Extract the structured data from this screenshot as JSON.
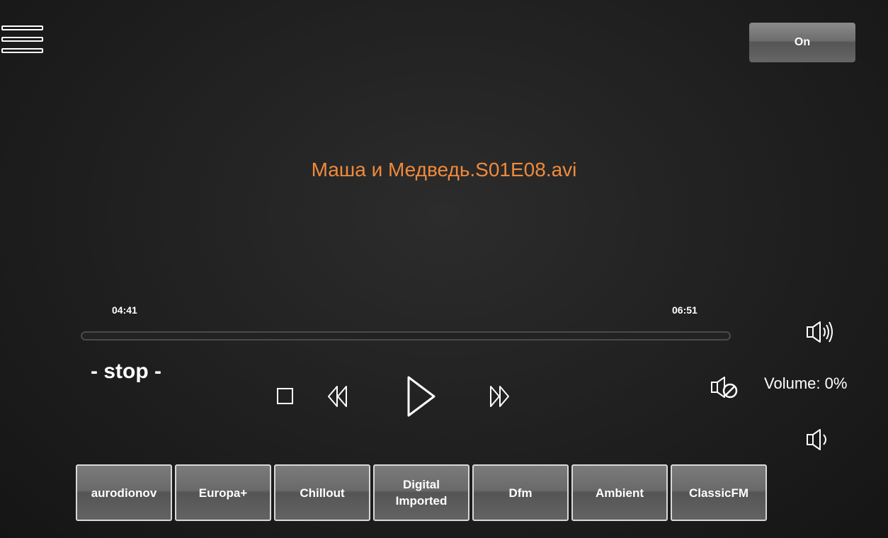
{
  "header": {
    "menu_icon": "hamburger-menu-icon",
    "power_label": "On"
  },
  "now_playing": {
    "title": "Маша и Медведь.S01E08.avi"
  },
  "playback": {
    "elapsed": "04:41",
    "total": "06:51",
    "progress_fraction": 0,
    "state_label": "- stop -"
  },
  "controls": {
    "stop_icon": "stop-icon",
    "rewind_icon": "rewind-icon",
    "play_icon": "play-icon",
    "forward_icon": "fast-forward-icon"
  },
  "volume": {
    "label": "Volume: 0%",
    "up_icon": "volume-up-icon",
    "mute_icon": "mute-icon",
    "down_icon": "volume-down-icon"
  },
  "stations": [
    {
      "label": "aurodionov"
    },
    {
      "label": "Europa+"
    },
    {
      "label": "Chillout"
    },
    {
      "label": "Digital\nImported"
    },
    {
      "label": "Dfm"
    },
    {
      "label": "Ambient"
    },
    {
      "label": "ClassicFM"
    }
  ]
}
